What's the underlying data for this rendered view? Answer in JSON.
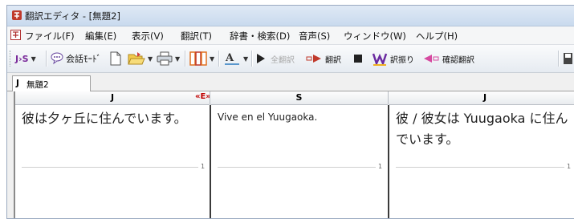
{
  "window": {
    "title": "翻訳エディタ - [無題2]"
  },
  "menu": [
    "ファイル(F)",
    "編集(E)",
    "表示(V)",
    "翻訳(T)",
    "辞書・検索(D)",
    "音声(S)",
    "ウィンドウ(W)",
    "ヘルプ(H)"
  ],
  "toolbar": {
    "lang_label": "J›S",
    "conversation_mode": "会話ﾓｰﾄﾞ",
    "translate_all": "全翻訳",
    "translate": "翻訳",
    "furigana": "訳振り",
    "confirm_translate": "確認翻訳"
  },
  "tab": {
    "lang": "J",
    "label": "無題2"
  },
  "columns": {
    "source": "J",
    "target": "S",
    "back": "J",
    "swap": "«E»"
  },
  "rows": [
    {
      "source": "彼は夕ヶ丘に住んでいます。",
      "target": "Vive en el Yuugaoka.",
      "back": "彼 / 彼女は Yuugaoka に住んでいます。",
      "number": "1"
    }
  ],
  "colors": {
    "swap": "#c00000",
    "titlebar": "#c9daee",
    "accent": "#7a2a9a"
  }
}
